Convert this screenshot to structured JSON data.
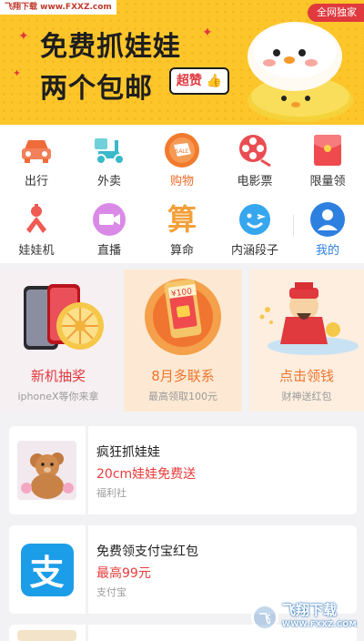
{
  "banner": {
    "watermark": "飞翔下载 www.FXXZ.com",
    "exclusive": "全网独家",
    "line1": "免费抓娃娃",
    "line2": "两个包邮",
    "badge": "超赞",
    "colors": {
      "background": "#fcc62b",
      "accent": "#e0393e"
    }
  },
  "categories": [
    {
      "label": "出行",
      "icon": "car-icon",
      "color": "#ef6b3a"
    },
    {
      "label": "外卖",
      "icon": "delivery-scooter-icon",
      "color": "#39b9c9"
    },
    {
      "label": "购物",
      "icon": "sale-tag-icon",
      "color": "#f27a2c",
      "active": true
    },
    {
      "label": "电影票",
      "icon": "film-reel-icon",
      "color": "#e94d52"
    },
    {
      "label": "限量领",
      "icon": "red-envelope-icon",
      "color": "#ef4a4e"
    },
    {
      "label": "娃娃机",
      "icon": "claw-machine-icon",
      "color": "#ef5a52"
    },
    {
      "label": "直播",
      "icon": "live-video-icon",
      "color": "#c66bd9"
    },
    {
      "label": "算命",
      "icon": "fortune-suan-icon",
      "glyph": "算",
      "color": "#f2a03a"
    },
    {
      "label": "内涵段子",
      "icon": "smile-face-icon",
      "color": "#36a6ee"
    },
    {
      "label": "我的",
      "icon": "user-profile-icon",
      "color": "#2e80e0",
      "mine": true
    }
  ],
  "promos": [
    {
      "title": "新机抽奖",
      "subtitle": "iphoneX等你来拿",
      "title_color": "#e0393e",
      "bg": "#f7f0f2"
    },
    {
      "title": "8月多联系",
      "subtitle": "最高领取100元",
      "amount": "¥100",
      "title_color": "#f07530",
      "bg": "#fde9d3"
    },
    {
      "title": "点击领钱",
      "subtitle": "财神送红包",
      "title_color": "#f07530",
      "bg": "#fdeedf"
    }
  ],
  "list": [
    {
      "title": "疯狂抓娃娃",
      "subtitle": "20cm娃娃免费送",
      "source": "福利社",
      "thumb": "teddy-bear-image"
    },
    {
      "title": "免费领支付宝红包",
      "subtitle": "最高99元",
      "source": "支付宝",
      "thumb": "alipay-logo-icon",
      "glyph": "支"
    },
    {
      "title": "",
      "subtitle": "",
      "source": "",
      "thumb": "partial-item-image"
    }
  ],
  "logo": {
    "brand": "飞翔下载",
    "url": "WWW.FXXZ.COM"
  }
}
